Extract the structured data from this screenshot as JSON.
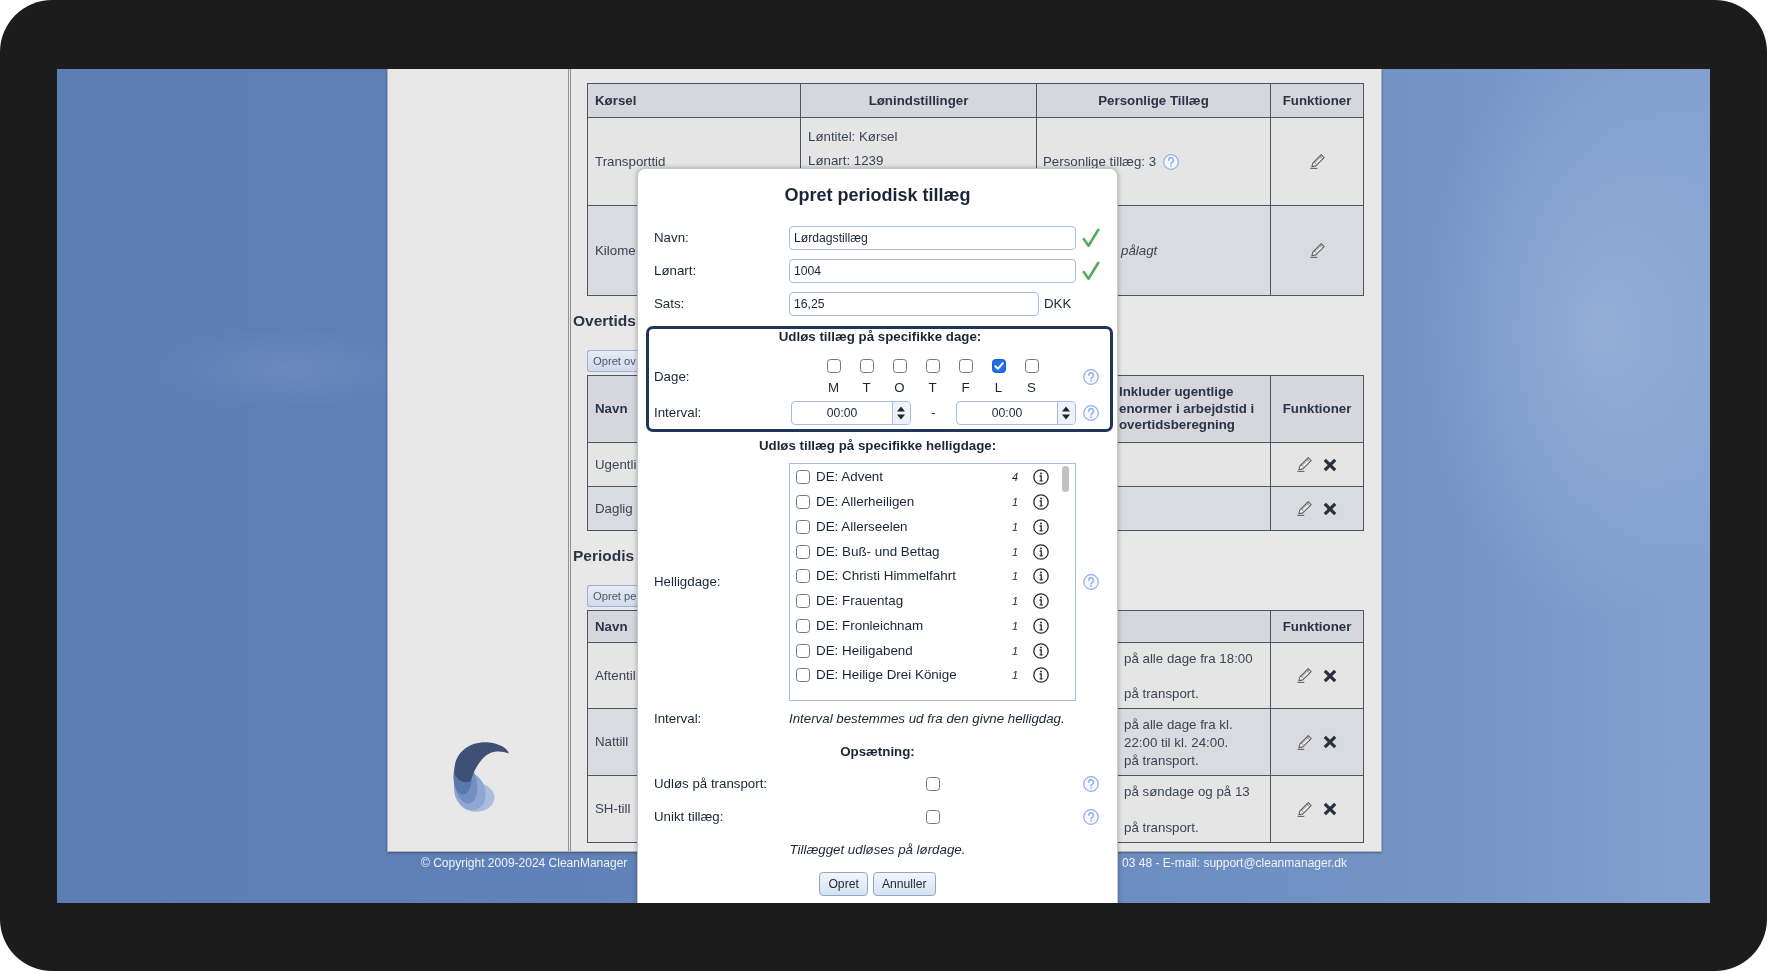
{
  "transport_table": {
    "columns": [
      "Kørsel",
      "Lønindstillinger",
      "Personlige Tillæg",
      "Funktioner"
    ],
    "rows": [
      {
        "name": "Transporttid",
        "salary": [
          "Løntitel: Kørsel",
          "Lønart: 1239"
        ],
        "personal": {
          "kind": "count",
          "text": "Personlige tillæg: 3"
        },
        "deletable": false
      },
      {
        "name": "Kilome",
        "personal": {
          "kind": "note",
          "text": "pålagt"
        },
        "deletable": false
      }
    ]
  },
  "overtime_section": {
    "heading": "Overtids",
    "button": "Opret ov",
    "columns": [
      "Navn",
      "Inkluder ugentlige enormer i arbejdstid i overtidsberegning",
      "Funktioner"
    ],
    "rows": [
      {
        "name": "Ugentli",
        "deletable": true
      },
      {
        "name": "Daglig",
        "deletable": true
      }
    ]
  },
  "periodic_section": {
    "heading": "Periodis",
    "button": "Opret pe",
    "columns": [
      "Navn",
      "Funktioner"
    ],
    "rows": [
      {
        "name": "Aftentil",
        "description": [
          "på alle dage fra 18:00",
          "på transport."
        ],
        "deletable": true
      },
      {
        "name": "Nattill",
        "description": [
          "på alle dage fra kl.",
          "22:00 til kl. 24:00.",
          "på transport."
        ],
        "deletable": true
      },
      {
        "name": "SH-till",
        "description": [
          "på søndage og på 13",
          "på transport."
        ],
        "deletable": true
      }
    ]
  },
  "footer": {
    "left": "© Copyright 2009-2024 CleanManager",
    "right": "03 48 - E-mail: support@cleanmanager.dk"
  },
  "dialog": {
    "title": "Opret periodisk tillæg",
    "fields": [
      {
        "label": "Navn:",
        "value": "Lørdagstillæg",
        "valid": true
      },
      {
        "label": "Lønart:",
        "value": "1004",
        "valid": true
      },
      {
        "label": "Sats:",
        "value": "16,25",
        "valid": false,
        "unit": "DKK"
      }
    ],
    "days_group": {
      "heading": "Udløs tillæg på specifikke dage:",
      "label": "Dage:",
      "days": [
        {
          "label": "M",
          "checked": false
        },
        {
          "label": "T",
          "checked": false
        },
        {
          "label": "O",
          "checked": false
        },
        {
          "label": "T",
          "checked": false
        },
        {
          "label": "F",
          "checked": false
        },
        {
          "label": "L",
          "checked": true
        },
        {
          "label": "S",
          "checked": false
        }
      ],
      "interval_label": "Interval:",
      "from": "00:00",
      "separator": "-",
      "to": "00:00"
    },
    "holidays": {
      "heading": "Udløs tillæg på specifikke helligdage:",
      "label": "Helligdage:",
      "items": [
        {
          "label": "DE: Advent",
          "count": "4",
          "checked": false
        },
        {
          "label": "DE: Allerheiligen",
          "count": "1",
          "checked": false
        },
        {
          "label": "DE: Allerseelen",
          "count": "1",
          "checked": false
        },
        {
          "label": "DE: Buß- und Bettag",
          "count": "1",
          "checked": false
        },
        {
          "label": "DE: Christi Himmelfahrt",
          "count": "1",
          "checked": false
        },
        {
          "label": "DE: Frauentag",
          "count": "1",
          "checked": false
        },
        {
          "label": "DE: Fronleichnam",
          "count": "1",
          "checked": false
        },
        {
          "label": "DE: Heiligabend",
          "count": "1",
          "checked": false
        },
        {
          "label": "DE: Heilige Drei Könige",
          "count": "1",
          "checked": false
        }
      ]
    },
    "holiday_interval": {
      "label": "Interval:",
      "text": "Interval bestemmes ud fra den givne helligdag."
    },
    "setup": {
      "heading": "Opsætning:",
      "options": [
        {
          "label": "Udløs på transport:",
          "checked": false
        },
        {
          "label": "Unikt tillæg:",
          "checked": false
        }
      ]
    },
    "summary": "Tillægget udløses på lørdage.",
    "buttons": [
      "Opret",
      "Annuller"
    ]
  }
}
